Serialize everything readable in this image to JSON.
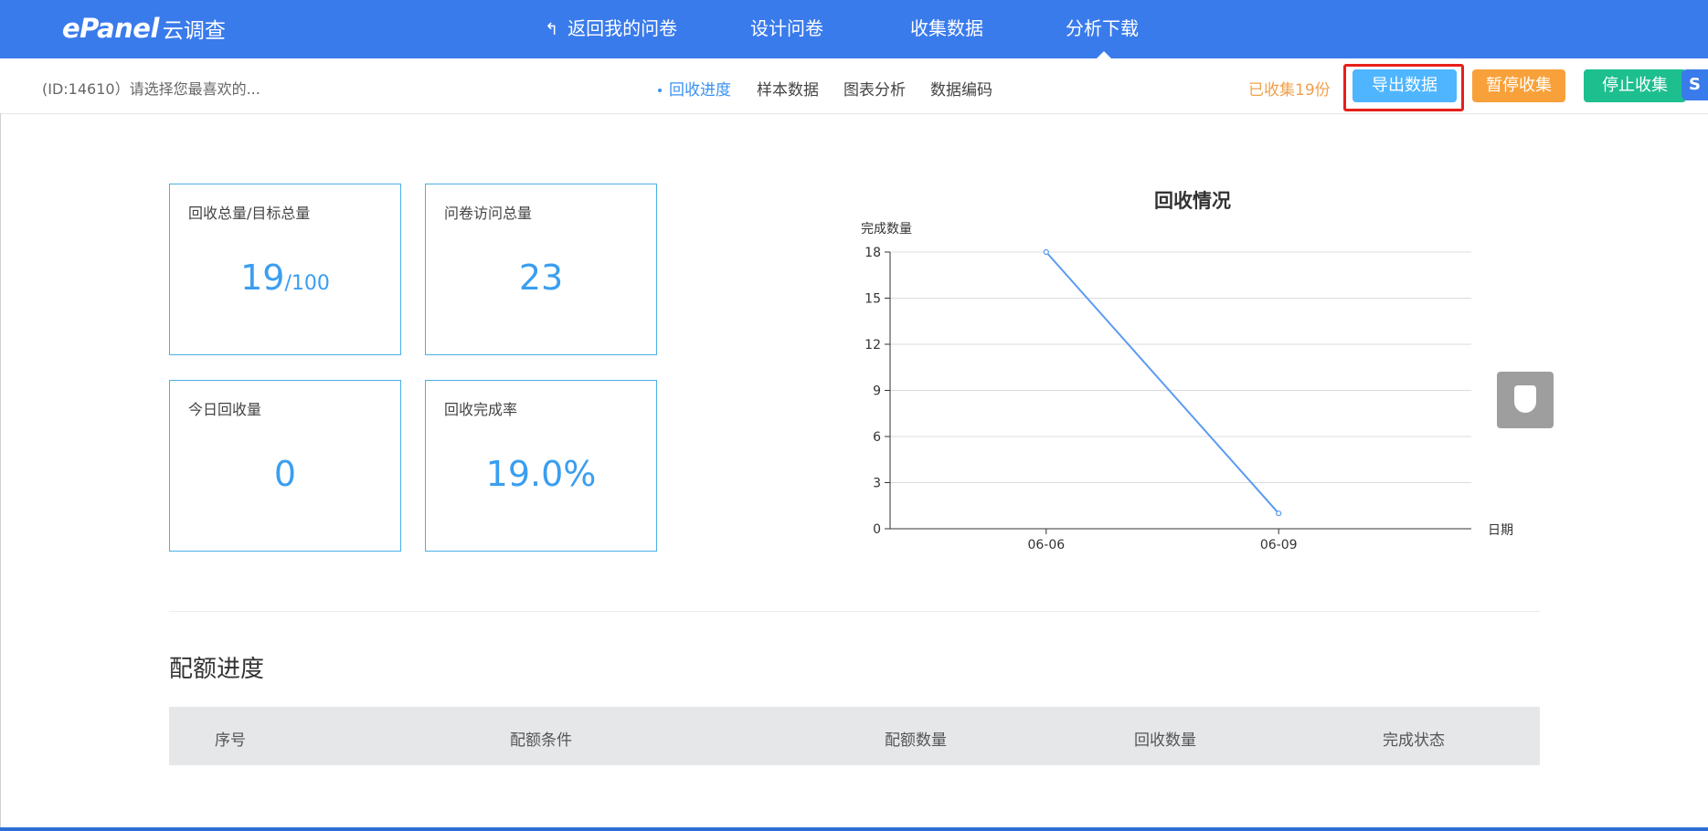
{
  "header": {
    "logo_main": "ePanel",
    "logo_sub": "云调查",
    "nav": [
      {
        "label": "返回我的问卷"
      },
      {
        "label": "设计问卷"
      },
      {
        "label": "收集数据"
      },
      {
        "label": "分析下载"
      }
    ],
    "active_nav": "分析下载"
  },
  "subbar": {
    "survey_title": "(ID:14610）请选择您最喜欢的...",
    "tabs": [
      {
        "label": "回收进度"
      },
      {
        "label": "样本数据"
      },
      {
        "label": "图表分析"
      },
      {
        "label": "数据编码"
      }
    ],
    "active_tab": "回收进度",
    "collected_text": "已收集19份",
    "buttons": {
      "export": "导出数据",
      "pause": "暂停收集",
      "stop": "停止收集"
    }
  },
  "stats": [
    {
      "label": "回收总量/目标总量",
      "value": "19",
      "suffix": "/100"
    },
    {
      "label": "问卷访问总量",
      "value": "23",
      "suffix": ""
    },
    {
      "label": "今日回收量",
      "value": "0",
      "suffix": ""
    },
    {
      "label": "回收完成率",
      "value": "19.0%",
      "suffix": ""
    }
  ],
  "chart_data": {
    "type": "line",
    "title": "回收情况",
    "ylabel": "完成数量",
    "xlabel": "日期",
    "categories": [
      "06-06",
      "06-09"
    ],
    "series": [
      {
        "values": [
          18,
          1
        ]
      }
    ],
    "yticks": [
      0,
      3,
      6,
      9,
      12,
      15,
      18
    ],
    "ylim": [
      0,
      18
    ],
    "grid": true,
    "color": "#5b9bf0"
  },
  "quota": {
    "title": "配额进度",
    "columns": [
      "序号",
      "配额条件",
      "配额数量",
      "回收数量",
      "完成状态"
    ]
  }
}
